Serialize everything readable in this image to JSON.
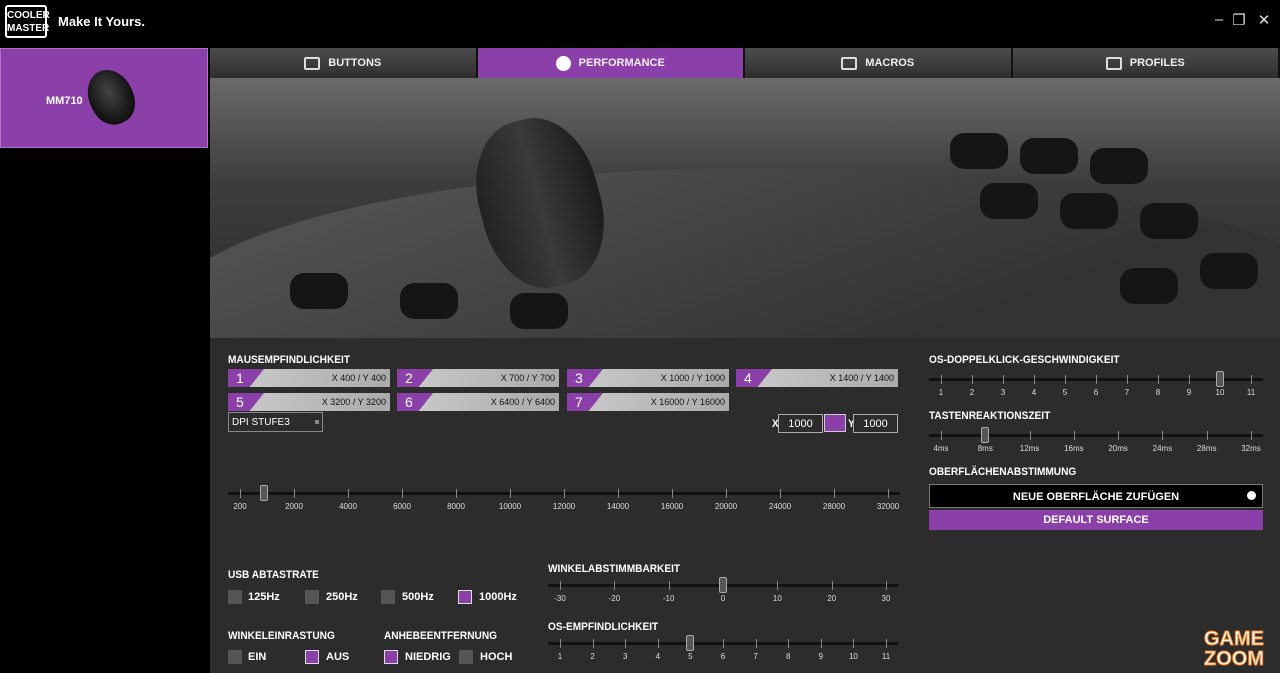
{
  "app": {
    "brand": "COOLER MASTER",
    "tagline": "Make It Yours.",
    "window_controls": [
      "–",
      "❐",
      "✕"
    ]
  },
  "tabs": [
    {
      "label": "BUTTONS",
      "icon": "buttons-icon",
      "active": false
    },
    {
      "label": "PERFORMANCE",
      "icon": "performance-icon",
      "active": true
    },
    {
      "label": "MACROS",
      "icon": "macros-icon",
      "active": false
    },
    {
      "label": "PROFILES",
      "icon": "profiles-icon",
      "active": false
    }
  ],
  "sidebar": {
    "device_name": "MM710"
  },
  "sensitivity": {
    "title": "MAUSEMPFINDLICHKEIT",
    "stages": [
      {
        "n": "1",
        "value": "X 400 / Y 400"
      },
      {
        "n": "2",
        "value": "X 700 / Y 700"
      },
      {
        "n": "3",
        "value": "X 1000 / Y 1000"
      },
      {
        "n": "4",
        "value": "X 1400 / Y 1400"
      },
      {
        "n": "5",
        "value": "X 3200 / Y 3200"
      },
      {
        "n": "6",
        "value": "X 6400 / Y 6400"
      },
      {
        "n": "7",
        "value": "X 16000 / Y 16000"
      }
    ],
    "selected_stage": "DPI STUFE3",
    "x_label": "X",
    "x_value": "1000",
    "y_label": "Y",
    "y_value": "1000",
    "ticks": [
      "200",
      "2000",
      "4000",
      "6000",
      "8000",
      "10000",
      "12000",
      "14000",
      "16000",
      "20000",
      "24000",
      "28000",
      "32000"
    ],
    "slider_value": 1000
  },
  "usb": {
    "title": "USB ABTASTRATE",
    "options": [
      {
        "label": "125Hz",
        "checked": false
      },
      {
        "label": "250Hz",
        "checked": false
      },
      {
        "label": "500Hz",
        "checked": false
      },
      {
        "label": "1000Hz",
        "checked": true
      }
    ]
  },
  "angle_snap": {
    "title": "WINKELEINRASTUNG",
    "options": [
      {
        "label": "EIN",
        "checked": false
      },
      {
        "label": "AUS",
        "checked": true
      }
    ]
  },
  "lift_off": {
    "title": "ANHEBEENTFERNUNG",
    "options": [
      {
        "label": "NIEDRIG",
        "checked": true
      },
      {
        "label": "HOCH",
        "checked": false
      }
    ]
  },
  "angle_tuning": {
    "title": "WINKELABSTIMMBARKEIT",
    "ticks": [
      "-30",
      "-20",
      "-10",
      "0",
      "10",
      "20",
      "30"
    ],
    "value": 0
  },
  "os_sensitivity": {
    "title": "OS-EMPFINDLICHKEIT",
    "ticks": [
      "1",
      "2",
      "3",
      "4",
      "5",
      "6",
      "7",
      "8",
      "9",
      "10",
      "11"
    ],
    "value": 5
  },
  "double_click": {
    "title": "OS-DOPPELKLICK-GESCHWINDIGKEIT",
    "ticks": [
      "1",
      "2",
      "3",
      "4",
      "5",
      "6",
      "7",
      "8",
      "9",
      "10",
      "11"
    ],
    "value": 10
  },
  "response": {
    "title": "TASTENREAKTIONSZEIT",
    "ticks": [
      "4ms",
      "8ms",
      "12ms",
      "16ms",
      "20ms",
      "24ms",
      "28ms",
      "32ms"
    ],
    "value": "8ms"
  },
  "surface": {
    "title": "OBERFLÄCHENABSTIMMUNG",
    "add_label": "NEUE OBERFLÄCHE ZUFÜGEN",
    "default_label": "DEFAULT SURFACE"
  },
  "watermark": {
    "line1": "GAME",
    "line2": "ZOOM"
  }
}
